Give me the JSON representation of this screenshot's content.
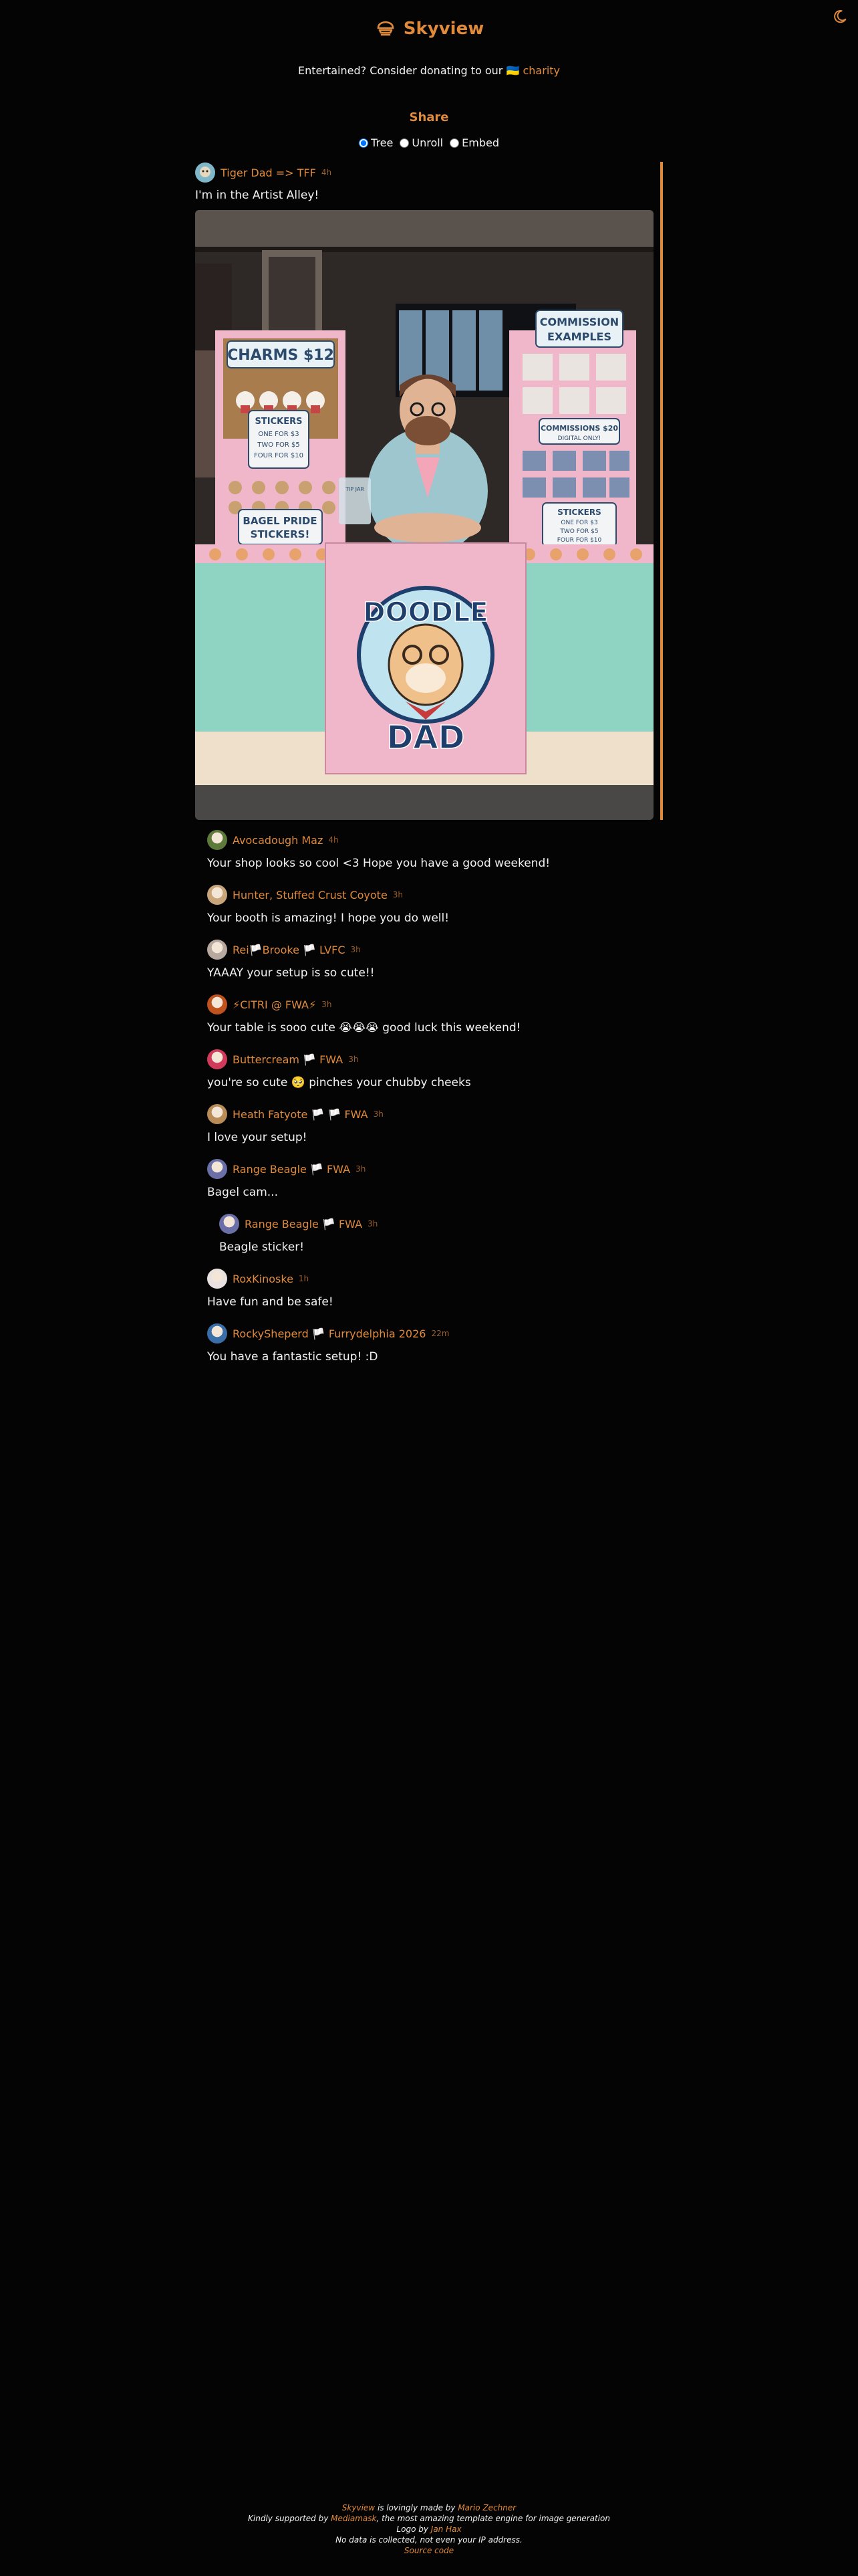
{
  "header": {
    "title": "Skyview",
    "theme_icon": "moon-icon",
    "logo_icon": "cloud-logo-icon"
  },
  "donate": {
    "prefix": "Entertained? Consider donating to our",
    "link": "🇺🇦 charity"
  },
  "share": {
    "title": "Share",
    "options": [
      {
        "label": "Tree",
        "checked": true
      },
      {
        "label": "Unroll",
        "checked": false
      },
      {
        "label": "Embed",
        "checked": false
      }
    ]
  },
  "post": {
    "author": "Tiger Dad => TFF",
    "time": "4h",
    "text": "I'm in the Artist Alley!",
    "image": {
      "charms_sign": "CHARMS $12",
      "commission_sign": [
        "COMMISSION",
        "EXAMPLES"
      ],
      "stickers_sign": [
        "STICKERS",
        "ONE FOR $3",
        "TWO FOR $5",
        "FOUR FOR $10"
      ],
      "bagel_sign": [
        "BAGEL PRIDE",
        "STICKERS!"
      ],
      "commissions_price": [
        "COMMISSIONS $20",
        "DIGITAL ONLY!"
      ],
      "stickers_right": [
        "STICKERS",
        "ONE FOR $3",
        "TWO FOR $5",
        "FOUR FOR $10"
      ],
      "banner": [
        "DOODLE",
        "DAD"
      ],
      "tip_jar": "TIP JAR"
    }
  },
  "replies": [
    {
      "author": "Avocadough Maz",
      "time": "4h",
      "text": "Your shop looks so cool <3 Hope you have a good weekend!",
      "avatar": "#5d7a3a",
      "nested": false
    },
    {
      "author": "Hunter, Stuffed Crust Coyote",
      "time": "3h",
      "text": "Your booth is amazing! I hope you do well!",
      "avatar": "#c9a57a",
      "nested": false
    },
    {
      "author": "Rei🏳️Brooke 🏳️ LVFC",
      "time": "3h",
      "text": "YAAAY your setup is so cute!!",
      "avatar": "#b7a8a0",
      "nested": false
    },
    {
      "author": "⚡CITRI @ FWA⚡",
      "time": "3h",
      "text": "Your table is sooo cute 😭😭😭 good luck this weekend!",
      "avatar": "#c0521e",
      "nested": false
    },
    {
      "author": "Buttercream 🏳️ FWA",
      "time": "3h",
      "text": "you're so cute 🥺 pinches your chubby cheeks",
      "avatar": "#d23a5c",
      "nested": false
    },
    {
      "author": "Heath Fatyote 🏳️ 🏳️ FWA",
      "time": "3h",
      "text": "I love your setup!",
      "avatar": "#b98b57",
      "nested": false
    },
    {
      "author": "Range Beagle 🏳️ FWA",
      "time": "3h",
      "text": "Bagel cam...",
      "avatar": "#6a6fa8",
      "nested": false
    },
    {
      "author": "Range Beagle 🏳️ FWA",
      "time": "3h",
      "text": "Beagle sticker!",
      "avatar": "#6a6fa8",
      "nested": true
    },
    {
      "author": "RoxKinoske",
      "time": "1h",
      "text": "Have fun and be safe!",
      "avatar": "#e9e2e0",
      "nested": false
    },
    {
      "author": "RockySheperd 🏳️ Furrydelphia 2026",
      "time": "22m",
      "text": "You have a fantastic setup! :D",
      "avatar": "#3a6ea8",
      "nested": false
    }
  ],
  "footer": {
    "line1_link": "Skyview",
    "line1_text": "is lovingly made by",
    "line1_author": "Mario Zechner",
    "line2_prefix": "Kindly supported by",
    "line2_link": "Mediamask",
    "line2_suffix": ", the most amazing template engine for image generation",
    "line3_prefix": "Logo by",
    "line3_link": "Jan Hax",
    "line4": "No data is collected, not even your IP address.",
    "line5": "Source code"
  }
}
